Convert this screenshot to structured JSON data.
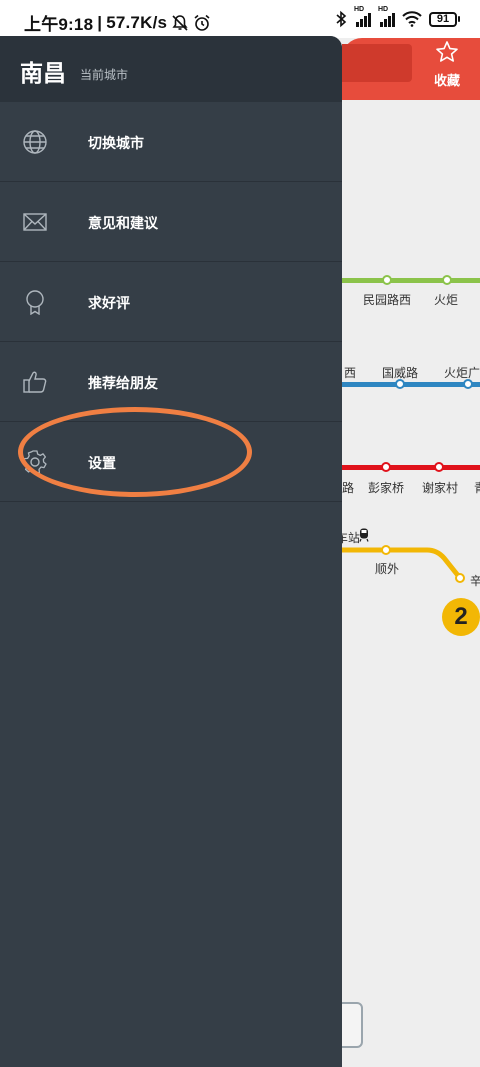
{
  "status_bar": {
    "time": "上午9:18",
    "separator": "|",
    "network_speed": "57.7K/s",
    "signal_label_1": "HD",
    "signal_label_2": "HD",
    "battery": "91",
    "icons": [
      "mute-icon",
      "alarm-icon",
      "bluetooth-icon",
      "signal-icon",
      "signal-icon",
      "wifi-icon",
      "battery-icon"
    ]
  },
  "drawer": {
    "city": "南昌",
    "city_subtitle": "当前城市",
    "items": [
      {
        "label": "切换城市",
        "icon": "globe-icon"
      },
      {
        "label": "意见和建议",
        "icon": "mail-icon"
      },
      {
        "label": "求好评",
        "icon": "award-icon"
      },
      {
        "label": "推荐给朋友",
        "icon": "thumbs-up-icon"
      },
      {
        "label": "设置",
        "icon": "gear-icon"
      }
    ]
  },
  "map_header": {
    "favorite_label": "收藏"
  },
  "map": {
    "line_badge": "2",
    "stations": {
      "green_1": "民园路西",
      "green_2": "火炬",
      "blue_1": "西",
      "blue_2": "国威路",
      "blue_3": "火炬广",
      "red_1": "路",
      "red_2": "彭家桥",
      "red_3": "谢家村",
      "red_4": "青",
      "yellow_1": "车站",
      "yellow_2": "顺外",
      "yellow_3": "辛"
    },
    "colors": {
      "green": "#8bc34a",
      "blue": "#2e86c1",
      "red": "#e0121b",
      "yellow": "#f2b705",
      "accent": "#e74c3c",
      "drawer": "#353e47",
      "highlight": "#f07f43"
    }
  }
}
